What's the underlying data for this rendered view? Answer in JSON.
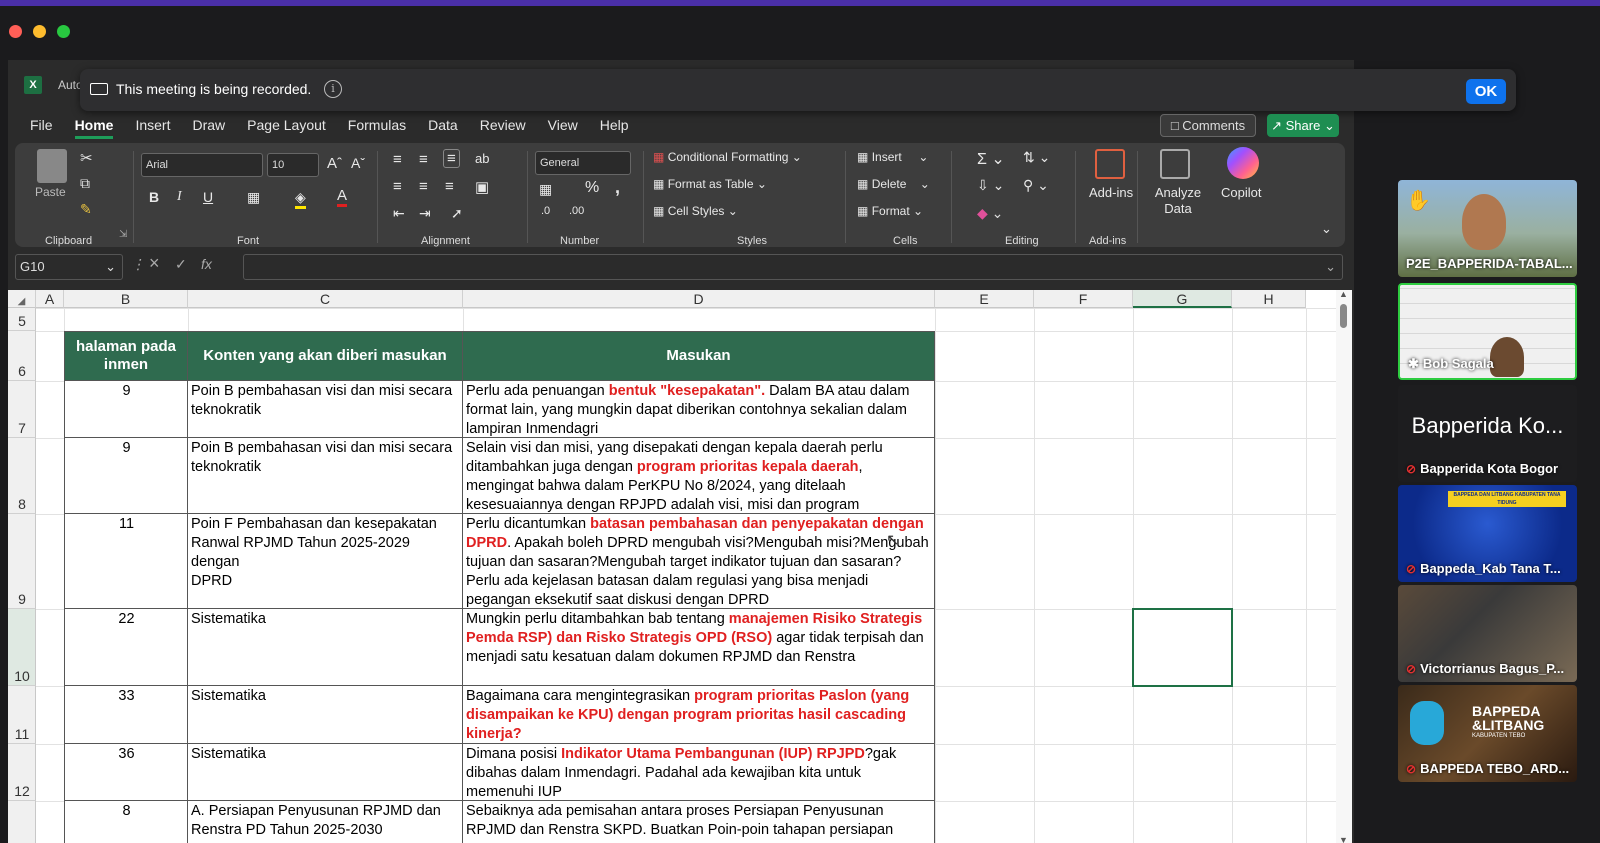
{
  "window": {
    "app_short": "Auto"
  },
  "banner": {
    "message": "This meeting is being recorded.",
    "info": "i",
    "ok_label": "OK"
  },
  "menu": [
    "File",
    "Home",
    "Insert",
    "Draw",
    "Page Layout",
    "Formulas",
    "Data",
    "Review",
    "View",
    "Help"
  ],
  "menu_active": "Home",
  "topbuttons": {
    "comments": "Comments",
    "share": "Share"
  },
  "ribbon": {
    "paste": "Paste",
    "font_name": "Arial",
    "font_size": "10",
    "number_format": "General",
    "bold": "B",
    "italic": "I",
    "underline": "U",
    "conditional_formatting": "Conditional Formatting",
    "format_as_table": "Format as Table",
    "cell_styles": "Cell Styles",
    "insert": "Insert",
    "delete": "Delete",
    "format": "Format",
    "addins": "Add-ins",
    "analyze_data": "Analyze Data",
    "copilot": "Copilot",
    "groups": {
      "clipboard": "Clipboard",
      "font": "Font",
      "alignment": "Alignment",
      "number": "Number",
      "styles": "Styles",
      "cells": "Cells",
      "editing": "Editing",
      "addins": "Add-ins"
    }
  },
  "formula_bar": {
    "name_box": "G10",
    "fx": "fx"
  },
  "columns": [
    "A",
    "B",
    "C",
    "D",
    "E",
    "F",
    "G",
    "H"
  ],
  "rows": [
    "5",
    "6",
    "7",
    "8",
    "9",
    "10",
    "11",
    "12"
  ],
  "table_header": {
    "b": "halaman pada inmen",
    "c": "Konten yang akan diberi masukan",
    "d": "Masukan"
  },
  "table_rows": [
    {
      "b": "9",
      "c": "Poin B pembahasan visi dan misi secara teknokratik",
      "d": [
        {
          "t": "Perlu ada penuangan "
        },
        {
          "t": "bentuk \"kesepakatan\".",
          "r": true
        },
        {
          "t": " Dalam BA atau dalam format lain, yang mungkin dapat diberikan contohnya sekalian dalam lampiran Inmendagri"
        }
      ]
    },
    {
      "b": "9",
      "c": "Poin B pembahasan visi dan misi secara teknokratik",
      "d": [
        {
          "t": "Selain visi dan misi, yang disepakati dengan kepala daerah perlu ditambahkan juga dengan "
        },
        {
          "t": "program prioritas kepala daerah",
          "r": true
        },
        {
          "t": ", mengingat bahwa dalam PerKPU No 8/2024, yang ditelaah kesesuaiannya dengan RPJPD adalah visi, misi dan program"
        }
      ]
    },
    {
      "b": "11",
      "c": "Poin F Pembahasan dan kesepakatan Ranwal RPJMD Tahun 2025-2029 dengan\nDPRD",
      "d": [
        {
          "t": "Perlu dicantumkan "
        },
        {
          "t": "batasan pembahasan dan penyepakatan dengan DPRD",
          "r": true
        },
        {
          "t": ". Apakah boleh DPRD mengubah visi?Mengubah misi?Mengubah tujuan dan sasaran?Mengubah target indikator tujuan dan sasaran?Perlu ada kejelasan batasan dalam regulasi yang bisa menjadi pegangan eksekutif saat diskusi dengan DPRD"
        }
      ]
    },
    {
      "b": "22",
      "c": "Sistematika",
      "d": [
        {
          "t": "Mungkin perlu ditambahkan bab tentang "
        },
        {
          "t": "manajemen Risiko Strategis Pemda RSP) dan Risko Strategis OPD (RSO)",
          "r": true
        },
        {
          "t": " agar tidak terpisah dan menjadi satu kesatuan dalam dokumen RPJMD dan Renstra"
        }
      ]
    },
    {
      "b": "33",
      "c": "Sistematika",
      "d": [
        {
          "t": "Bagaimana cara mengintegrasikan "
        },
        {
          "t": "program prioritas Paslon (yang disampaikan ke KPU) dengan program prioritas hasil cascading kinerja?",
          "r": true
        }
      ]
    },
    {
      "b": "36",
      "c": "Sistematika",
      "d": [
        {
          "t": "Dimana posisi "
        },
        {
          "t": "Indikator Utama Pembangunan (IUP) RPJPD",
          "r": true
        },
        {
          "t": "?gak dibahas dalam Inmendagri. Padahal ada kewajiban kita untuk memenuhi IUP"
        }
      ]
    },
    {
      "b": "8",
      "c": "A. Persiapan Penyusunan RPJMD dan Renstra PD Tahun 2025-2030",
      "d": [
        {
          "t": "Sebaiknya ada pemisahan antara proses Persiapan Penyusunan RPJMD dan Renstra SKPD. Buatkan Poin-poin tahapan persiapan Penyusunan"
        }
      ]
    }
  ],
  "participants": [
    {
      "name": "P2E_BAPPERIDA-TABAL...",
      "muted": false,
      "hand": true
    },
    {
      "name": "Bob Sagala",
      "muted": false,
      "pinned": true
    },
    {
      "name": "Bapperida Kota Bogor",
      "title": "Bapperida Ko...",
      "muted": true
    },
    {
      "name": "Bappeda_Kab Tana T...",
      "muted": true,
      "logo": "BAPPEDA DAN LITBANG KABUPATEN TANA TIDUNG"
    },
    {
      "name": "Victorrianus Bagus_P...",
      "muted": true
    },
    {
      "name": "BAPPEDA TEBO_ARD...",
      "muted": true,
      "logo1": "BAPPEDA",
      "logo2": "&LITBANG",
      "logo3": "KABUPATEN TEBO"
    }
  ]
}
